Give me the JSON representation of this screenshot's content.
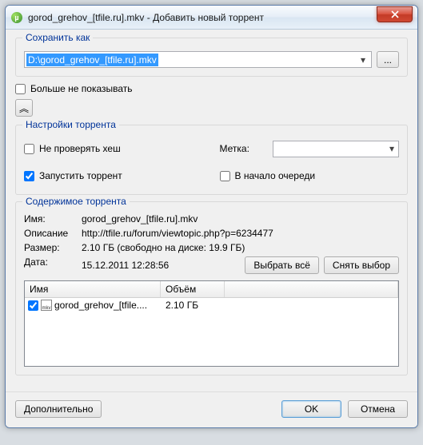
{
  "window": {
    "title": "gorod_grehov_[tfile.ru].mkv - Добавить новый торрент",
    "mu_glyph": "µ"
  },
  "save_as": {
    "legend": "Сохранить как",
    "path": "D:\\gorod_grehov_[tfile.ru].mkv",
    "browse": "..."
  },
  "dont_show": "Больше не показывать",
  "collapse_glyph": "︽",
  "torrent_settings": {
    "legend": "Настройки торрента",
    "no_hash": "Не проверять хеш",
    "start": "Запустить торрент",
    "label_text": "Метка:",
    "queue_front": "В начало очереди"
  },
  "contents": {
    "legend": "Содержимое торрента",
    "name_lbl": "Имя:",
    "name_val": "gorod_grehov_[tfile.ru].mkv",
    "desc_lbl": "Описание",
    "desc_val": "http://tfile.ru/forum/viewtopic.php?p=6234477",
    "size_lbl": "Размер:",
    "size_val": "2.10 ГБ (свободно на диске: 19.9 ГБ)",
    "date_lbl": "Дата:",
    "date_val": "15.12.2011 12:28:56",
    "select_all": "Выбрать всё",
    "deselect": "Снять выбор",
    "col_name": "Имя",
    "col_size": "Объём",
    "file_name": "gorod_grehov_[tfile....",
    "file_size": "2.10 ГБ"
  },
  "footer": {
    "advanced": "Дополнительно",
    "ok": "OK",
    "cancel": "Отмена"
  }
}
